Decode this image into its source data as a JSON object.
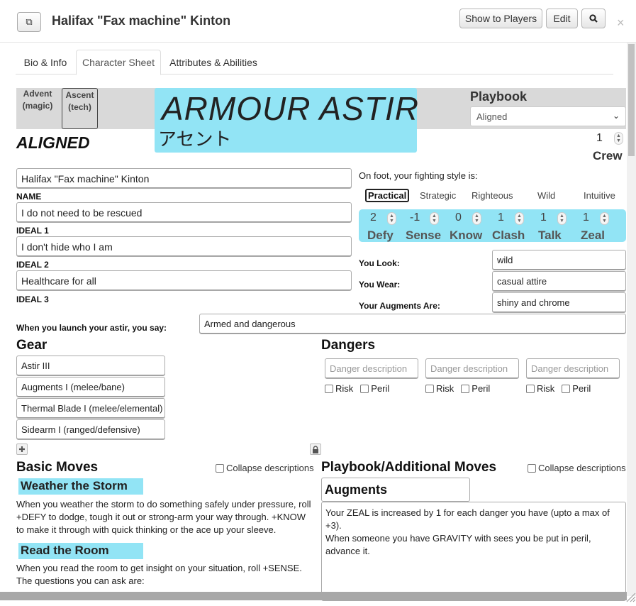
{
  "window": {
    "title": "Halifax \"Fax machine\" Kinton",
    "buttons": {
      "show_players": "Show to Players",
      "edit": "Edit"
    }
  },
  "tabs": [
    "Bio & Info",
    "Character Sheet",
    "Attributes & Abilities"
  ],
  "header": {
    "advent_line1": "Advent",
    "advent_line2": "(magic)",
    "ascent_line1": "Ascent",
    "ascent_line2": "(tech)",
    "astir_title": "ARMOUR ASTIR",
    "astir_subtitle": "アセント",
    "playbook_label": "Playbook",
    "playbook_value": "Aligned",
    "playbook_heading": "ALIGNED",
    "crew_value": "1",
    "crew_label": "Crew"
  },
  "identity": {
    "name_value": "Halifax \"Fax machine\" Kinton",
    "name_label": "NAME",
    "ideal1_value": "I do not need to be rescued",
    "ideal1_label": "IDEAL 1",
    "ideal2_value": "I don't hide who I am",
    "ideal2_label": "IDEAL 2",
    "ideal3_value": "Healthcare for all",
    "ideal3_label": "IDEAL 3"
  },
  "fighting": {
    "label": "On foot, your fighting style is:",
    "options": [
      "Practical",
      "Strategic",
      "Righteous",
      "Wild",
      "Intuitive"
    ],
    "selected": "Practical"
  },
  "stats": [
    {
      "name": "Defy",
      "value": "2"
    },
    {
      "name": "Sense",
      "value": "-1"
    },
    {
      "name": "Know",
      "value": "0"
    },
    {
      "name": "Clash",
      "value": "1"
    },
    {
      "name": "Talk",
      "value": "1"
    },
    {
      "name": "Zeal",
      "value": "1"
    }
  ],
  "look": {
    "look_label": "You Look:",
    "look_value": "wild",
    "wear_label": "You Wear:",
    "wear_value": "casual attire",
    "augments_label": "Your Augments Are:",
    "augments_value": "shiny and chrome"
  },
  "launch": {
    "label": "When you launch your astir, you say:",
    "value": "Armed and dangerous"
  },
  "gear": {
    "heading": "Gear",
    "items": [
      "Astir III",
      "Augments I (melee/bane)",
      "Thermal Blade I (melee/elemental)",
      "Sidearm I (ranged/defensive)"
    ]
  },
  "dangers": {
    "heading": "Dangers",
    "placeholder": "Danger description",
    "risk_label": "Risk",
    "peril_label": "Peril"
  },
  "basic_moves": {
    "heading": "Basic Moves",
    "collapse_label": "Collapse descriptions",
    "moves": [
      {
        "title": "Weather the Storm",
        "text": "When you weather the storm to do something safely under pressure, roll +DEFY to dodge, tough it out or strong-arm your way through. +KNOW to make it through with quick thinking or the ace up your sleeve."
      },
      {
        "title": "Read the Room",
        "line1": "When you read the room to get insight on your situation, roll +SENSE.",
        "line2": "The questions you can ask are:"
      }
    ]
  },
  "playbook_moves": {
    "heading": "Playbook/Additional Moves",
    "collapse_label": "Collapse descriptions",
    "move_name": "Augments",
    "line1": "Your ZEAL is increased by 1 for each danger you have (upto a max of +3).",
    "line2": "When someone you have GRAVITY with sees you be put in peril, advance it."
  },
  "colors": {
    "accent": "#92e4f5",
    "band": "#d9d9d9"
  }
}
